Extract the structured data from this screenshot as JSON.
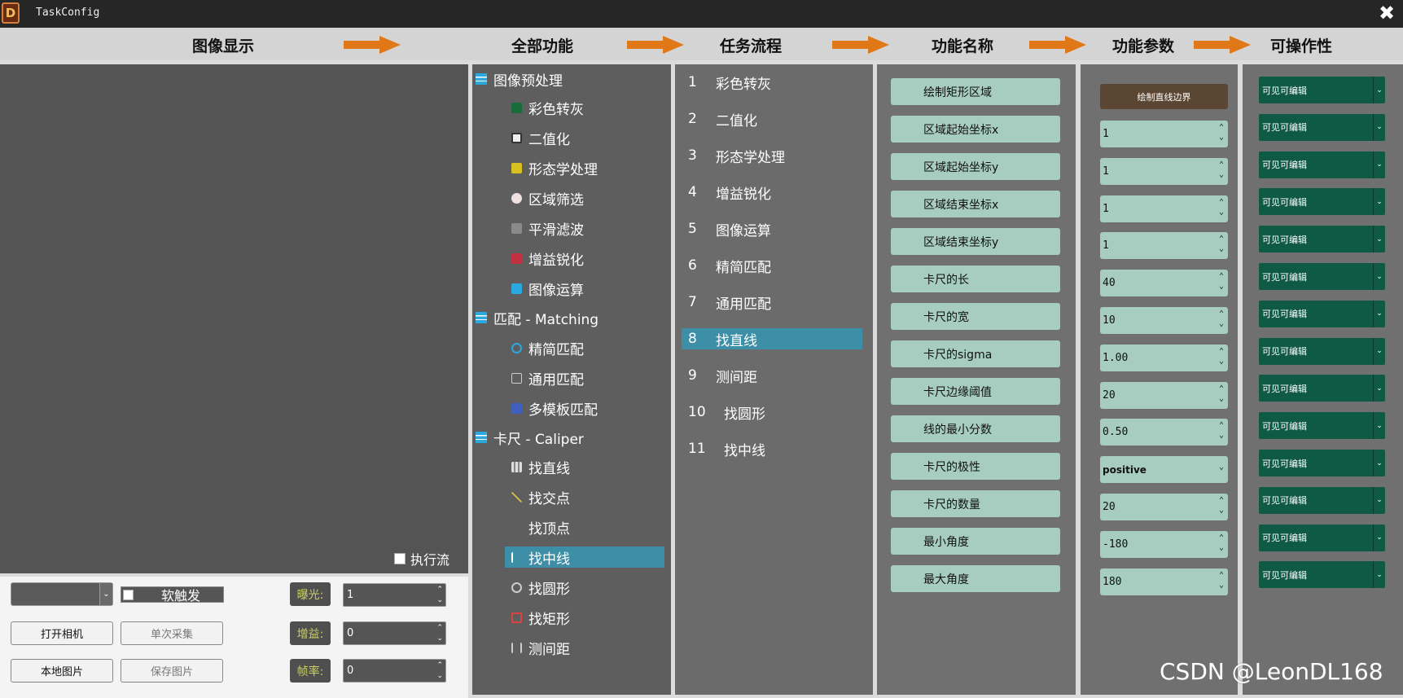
{
  "window": {
    "title": "TaskConfig",
    "logo": "D",
    "close_glyph": "✖"
  },
  "headers": [
    "图像显示",
    "全部功能",
    "任务流程",
    "功能名称",
    "功能参数",
    "可操作性"
  ],
  "image_display": {
    "exec_flow_label": "执行流"
  },
  "camera": {
    "soft_trigger_label": "软触发",
    "open_camera": "打开相机",
    "single_capture": "单次采集",
    "local_image": "本地图片",
    "save_image": "保存图片",
    "exposure_label": "曝光:",
    "exposure_value": "1",
    "gain_label": "增益:",
    "gain_value": "0",
    "framerate_label": "帧率:",
    "framerate_value": "0"
  },
  "tree": {
    "groups": [
      {
        "label": "图像预处理",
        "children": [
          "彩色转灰",
          "二值化",
          "形态学处理",
          "区域筛选",
          "平滑滤波",
          "增益锐化",
          "图像运算"
        ]
      },
      {
        "label": "匹配 - Matching",
        "children": [
          "精简匹配",
          "通用匹配",
          "多模板匹配"
        ]
      },
      {
        "label": "卡尺 - Caliper",
        "children": [
          "找直线",
          "找交点",
          "找顶点",
          "找中线",
          "找圆形",
          "找矩形",
          "测间距"
        ]
      }
    ],
    "selected": "找中线"
  },
  "flow": {
    "items": [
      {
        "num": "1",
        "label": "彩色转灰"
      },
      {
        "num": "2",
        "label": "二值化"
      },
      {
        "num": "3",
        "label": "形态学处理"
      },
      {
        "num": "4",
        "label": "增益锐化"
      },
      {
        "num": "5",
        "label": "图像运算"
      },
      {
        "num": "6",
        "label": "精简匹配"
      },
      {
        "num": "7",
        "label": "通用匹配"
      },
      {
        "num": "8",
        "label": "找直线"
      },
      {
        "num": "9",
        "label": "测间距"
      },
      {
        "num": "10",
        "label": "找圆形"
      },
      {
        "num": "11",
        "label": "找中线"
      }
    ],
    "selected_index": 7
  },
  "function_names": [
    "绘制矩形区域",
    "区域起始坐标x",
    "区域起始坐标y",
    "区域结束坐标x",
    "区域结束坐标y",
    "卡尺的长",
    "卡尺的宽",
    "卡尺的sigma",
    "卡尺边缘阈值",
    "线的最小分数",
    "卡尺的极性",
    "卡尺的数量",
    "最小角度",
    "最大角度"
  ],
  "params": {
    "draw_button": "绘制直线边界",
    "values": [
      "1",
      "1",
      "1",
      "1",
      "40",
      "10",
      "1.00",
      "20",
      "0.50",
      "positive",
      "20",
      "-180",
      "180"
    ],
    "dropdown_index": 9
  },
  "operability": {
    "option": "可见可编辑",
    "count": 14
  },
  "watermark": "CSDN @LeonDL168",
  "colors": {
    "accent_arrow": "#e07818",
    "selected_row": "#3d8fa8",
    "param_bg": "#a7ccc0",
    "op_bg": "#0e5a45"
  }
}
